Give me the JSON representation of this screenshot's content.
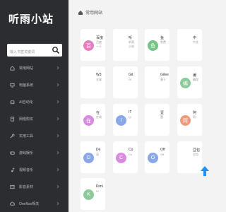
{
  "sidebar": {
    "logo": "听雨小站",
    "search_placeholder": "输入书签关键词",
    "items": [
      {
        "label": "常用网站",
        "icon": "home-icon"
      },
      {
        "label": "电脑系统",
        "icon": "monitor-icon"
      },
      {
        "label": "AI自动化",
        "icon": "robot-icon"
      },
      {
        "label": "网络购买",
        "icon": "cart-icon"
      },
      {
        "label": "实用工具",
        "icon": "wrench-icon"
      },
      {
        "label": "游戏娱乐",
        "icon": "gamepad-icon"
      },
      {
        "label": "视频音乐",
        "icon": "music-icon"
      },
      {
        "label": "影音素材",
        "icon": "film-icon"
      },
      {
        "label": "OneNav相关",
        "icon": "cloud-icon"
      }
    ]
  },
  "main": {
    "section_title": "常用网站",
    "cards": [
      {
        "name": "百度",
        "desc": "百度一下",
        "letter": "百",
        "color": "#e580c0"
      },
      {
        "name": "听",
        "desc": "听雨小站",
        "letter": "",
        "color": "#ffffff"
      },
      {
        "name": "鱼",
        "desc": "免费",
        "letter": "鱼",
        "color": "#74c486"
      },
      {
        "name": "中",
        "desc": "中文",
        "letter": "",
        "color": "#ffffff"
      },
      {
        "name": "W3",
        "desc": "全球",
        "letter": "",
        "color": "#ffffff"
      },
      {
        "name": "Git",
        "desc": "Gi",
        "letter": "",
        "color": "#ffffff"
      },
      {
        "name": "Gitee",
        "desc": "基于",
        "letter": "",
        "color": "#ffffff"
      },
      {
        "name": "编",
        "desc": "编程",
        "letter": "编",
        "color": "#8cc99b"
      },
      {
        "name": "在",
        "desc": "在线",
        "letter": "在",
        "color": "#d88be0"
      },
      {
        "name": "IT",
        "desc": "以",
        "letter": "I",
        "color": "#8aa8e8"
      },
      {
        "name": "壹",
        "desc": "壹",
        "letter": "",
        "color": "#ffffff"
      },
      {
        "name": "阿",
        "desc": "阿",
        "letter": "阿",
        "color": "#ee9a7e"
      },
      {
        "name": "De",
        "desc": "深",
        "letter": "D",
        "color": "#8aa8e8"
      },
      {
        "name": "Cu",
        "desc": "Cu",
        "letter": "C",
        "color": "#d88be0"
      },
      {
        "name": "Off",
        "desc": "Off",
        "letter": "O",
        "color": "#8aa8e8"
      },
      {
        "name": "豆包",
        "desc": "豆包",
        "letter": "",
        "color": "#ffffff"
      },
      {
        "name": "Kimi",
        "desc": "Ki",
        "letter": "K",
        "color": "#8cc99b"
      }
    ]
  },
  "colors": {
    "sidebar_bg": "#2b2d31",
    "page_bg": "#f3f3f3",
    "accent": "#1e90ff"
  }
}
